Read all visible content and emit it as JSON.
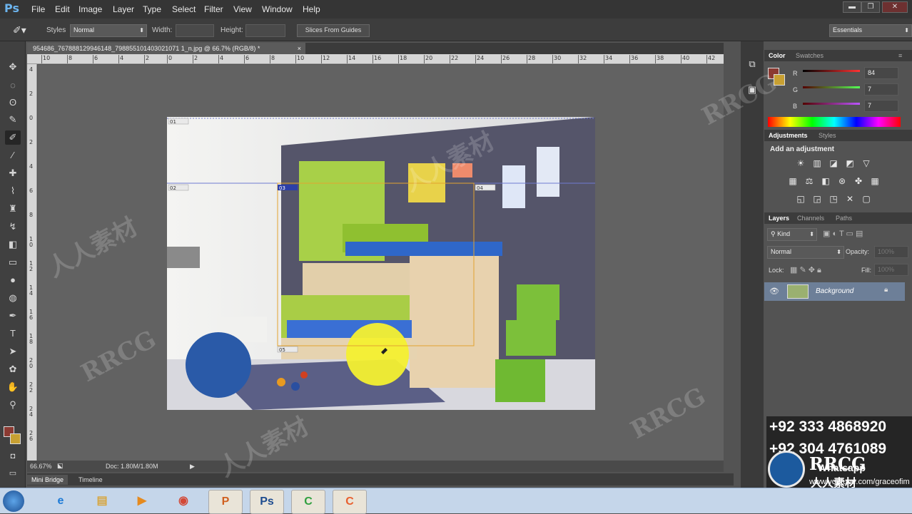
{
  "app": {
    "logo": "Ps"
  },
  "menu": [
    "File",
    "Edit",
    "Image",
    "Layer",
    "Type",
    "Select",
    "Filter",
    "View",
    "Window",
    "Help"
  ],
  "window_controls": [
    "▬",
    "❐",
    "✕"
  ],
  "options": {
    "styles_label": "Styles",
    "styles_value": "Normal",
    "width_label": "Width:",
    "height_label": "Height:",
    "slices_button": "Slices From Guides",
    "workspace": "Essentials"
  },
  "document": {
    "tab_title": "954686_767888129946148_798855101403021071 1_n.jpg @ 66.7% (RGB/8) *",
    "close": "×",
    "zoom": "66.67%",
    "doc_size": "Doc: 1.80M/1.80M"
  },
  "hruler_ticks": [
    "10",
    "8",
    "6",
    "4",
    "2",
    "0",
    "2",
    "4",
    "6",
    "8",
    "10",
    "12",
    "14",
    "16",
    "18",
    "20",
    "22",
    "24",
    "26",
    "28",
    "30",
    "32",
    "34",
    "36",
    "38",
    "40",
    "42"
  ],
  "vruler_ticks": [
    "4",
    "2",
    "0",
    "2",
    "4",
    "6",
    "8",
    "10",
    "12",
    "14",
    "16",
    "18",
    "20",
    "22",
    "24",
    "26"
  ],
  "slice_labels": [
    "01",
    "02",
    "03",
    "04",
    "05"
  ],
  "bottom_tabs": [
    "Mini Bridge",
    "Timeline"
  ],
  "color_panel": {
    "tabs": [
      "Color",
      "Swatches"
    ],
    "fg": "#8b3a32",
    "bg": "#c8a032",
    "channels": [
      {
        "label": "R",
        "value": "84"
      },
      {
        "label": "G",
        "value": "7"
      },
      {
        "label": "B",
        "value": "7"
      }
    ]
  },
  "adjustments_panel": {
    "tabs": [
      "Adjustments",
      "Styles"
    ],
    "heading": "Add an adjustment",
    "icons": [
      "brightness-icon",
      "levels-icon",
      "curves-icon",
      "exposure-icon",
      "vibrance-icon",
      "hue-icon",
      "balance-icon",
      "bw-icon",
      "photo-filter-icon",
      "channel-mixer-icon",
      "color-lookup-icon",
      "invert-icon",
      "posterize-icon",
      "threshold-icon",
      "selective-color-icon",
      "gradient-map-icon"
    ]
  },
  "layers_panel": {
    "tabs": [
      "Layers",
      "Channels",
      "Paths"
    ],
    "kind": "Kind",
    "blend": "Normal",
    "opacity_label": "Opacity:",
    "opacity_value": "100%",
    "lock_label": "Lock:",
    "fill_label": "Fill:",
    "fill_value": "100%",
    "layer_name": "Background"
  },
  "overlay": {
    "phone1": "+92 333 4868920",
    "phone2": "+92 304 4761089",
    "whatsapp": "Whatsapp",
    "url": "www.youtube.com/graceofim",
    "brand": "RRCG",
    "brand_sub": "人人素材"
  },
  "watermark": [
    "RRCG",
    "人人素材"
  ]
}
